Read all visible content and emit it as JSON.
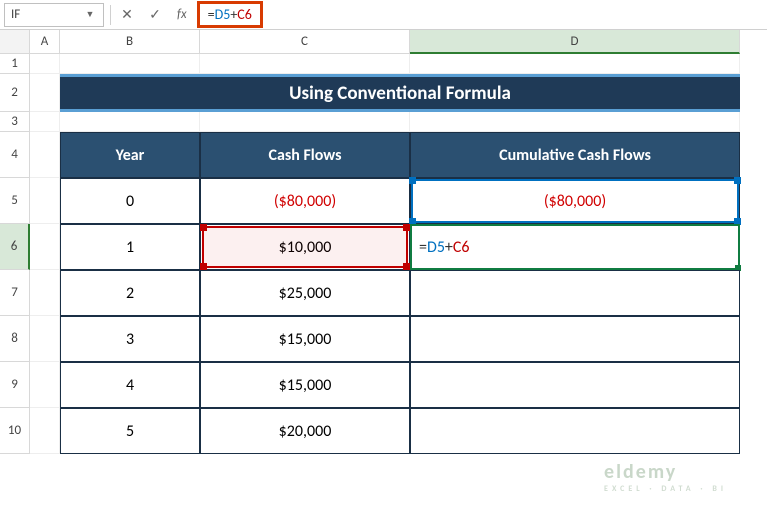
{
  "formula_bar": {
    "name_box": "IF",
    "cancel_icon": "✕",
    "accept_icon": "✓",
    "fx_label": "fx",
    "formula_eq": "=",
    "formula_ref1": "D5",
    "formula_plus": "+",
    "formula_ref2": "C6"
  },
  "columns": {
    "A": "A",
    "B": "B",
    "C": "C",
    "D": "D"
  },
  "rows": {
    "r1": "1",
    "r2": "2",
    "r3": "3",
    "r4": "4",
    "r5": "5",
    "r6": "6",
    "r7": "7",
    "r8": "8",
    "r9": "9",
    "r10": "10"
  },
  "title": "Using Conventional Formula",
  "headers": {
    "year": "Year",
    "cash": "Cash Flows",
    "cum": "Cumulative Cash Flows"
  },
  "data": {
    "r5": {
      "year": "0",
      "cash": "($80,000)",
      "cum": "($80,000)"
    },
    "r6": {
      "year": "1",
      "cash": "$10,000",
      "cum_edit_eq": "=",
      "cum_edit_r1": "D5",
      "cum_edit_p": "+",
      "cum_edit_r2": "C6"
    },
    "r7": {
      "year": "2",
      "cash": "$25,000"
    },
    "r8": {
      "year": "3",
      "cash": "$15,000"
    },
    "r9": {
      "year": "4",
      "cash": "$15,000"
    },
    "r10": {
      "year": "5",
      "cash": "$20,000"
    }
  },
  "chart_data": {
    "type": "table",
    "title": "Using Conventional Formula",
    "columns": [
      "Year",
      "Cash Flows",
      "Cumulative Cash Flows"
    ],
    "rows": [
      {
        "Year": 0,
        "Cash Flows": -80000,
        "Cumulative Cash Flows": -80000
      },
      {
        "Year": 1,
        "Cash Flows": 10000,
        "Cumulative Cash Flows": null
      },
      {
        "Year": 2,
        "Cash Flows": 25000,
        "Cumulative Cash Flows": null
      },
      {
        "Year": 3,
        "Cash Flows": 15000,
        "Cumulative Cash Flows": null
      },
      {
        "Year": 4,
        "Cash Flows": 15000,
        "Cumulative Cash Flows": null
      },
      {
        "Year": 5,
        "Cash Flows": 20000,
        "Cumulative Cash Flows": null
      }
    ],
    "active_formula": "=D5+C6"
  },
  "watermark": {
    "main": "eldemy",
    "sub": "EXCEL · DATA · BI"
  }
}
